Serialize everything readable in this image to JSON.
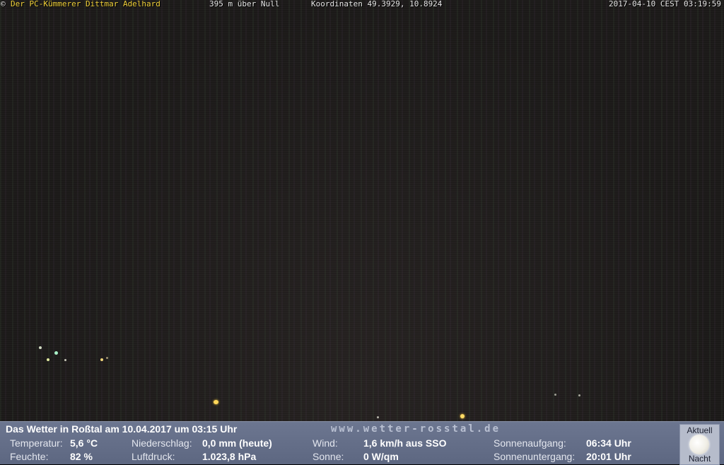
{
  "overlay": {
    "copyright": "©",
    "owner": "Der PC-Kümmerer Dittmar Adelhard",
    "altitude": "395 m über Null",
    "coordinates": "Koordinaten 49.3929, 10.8924",
    "datetime": "2017-04-10 CEST 03:19:59"
  },
  "weather": {
    "headline": "Das Wetter in Roßtal am 10.04.2017 um 03:15 Uhr",
    "website": "www.wetter-rosstal.de",
    "temperature_label": "Temperatur:",
    "temperature_value": "5,6 °C",
    "humidity_label": "Feuchte:",
    "humidity_value": "82 %",
    "precipitation_label": "Niederschlag:",
    "precipitation_value": "0,0 mm (heute)",
    "pressure_label": "Luftdruck:",
    "pressure_value": "1.023,8 hPa",
    "wind_label": "Wind:",
    "wind_value": "1,6 km/h aus SSO",
    "sun_label": "Sonne:",
    "sun_value": "0 W/qm",
    "sunrise_label": "Sonnenaufgang:",
    "sunrise_value": "06:34 Uhr",
    "sunset_label": "Sonnenuntergang:",
    "sunset_value": "20:01 Uhr"
  },
  "moon": {
    "top_label": "Aktuell",
    "bottom_label": "Nacht",
    "icon": "full-moon-icon"
  }
}
